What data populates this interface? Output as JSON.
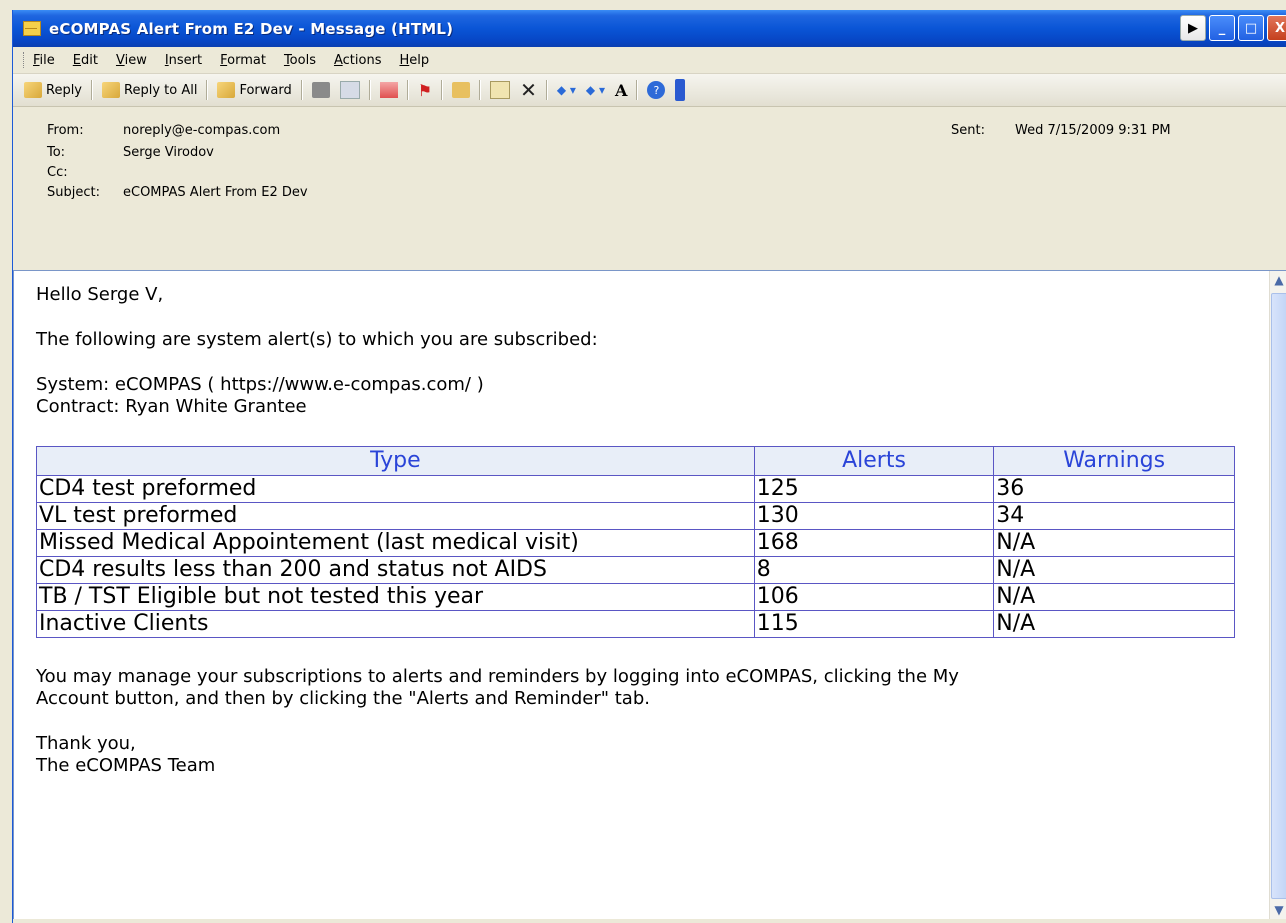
{
  "window": {
    "title": "eCOMPAS Alert From E2 Dev - Message (HTML)",
    "controls": {
      "play": "▶",
      "minimize": "_",
      "maximize": "□",
      "close": "X"
    }
  },
  "menu": [
    "File",
    "Edit",
    "View",
    "Insert",
    "Format",
    "Tools",
    "Actions",
    "Help"
  ],
  "toolbar": {
    "reply": "Reply",
    "reply_all": "Reply to All",
    "forward": "Forward",
    "font_size": "A",
    "help": "?"
  },
  "header": {
    "from_label": "From:",
    "from": "noreply@e-compas.com",
    "to_label": "To:",
    "to": "Serge Virodov",
    "cc_label": "Cc:",
    "cc": "",
    "subject_label": "Subject:",
    "subject": "eCOMPAS Alert From E2 Dev",
    "sent_label": "Sent:",
    "sent": "Wed 7/15/2009 9:31 PM"
  },
  "body": {
    "greeting": "Hello Serge V,",
    "intro": "The following are system alert(s) to which you are subscribed:",
    "system": "System: eCOMPAS ( https://www.e-compas.com/ )",
    "contract": "Contract: Ryan White Grantee",
    "table": {
      "headers": [
        "Type",
        "Alerts",
        "Warnings"
      ],
      "rows": [
        [
          "CD4 test preformed",
          "125",
          "36"
        ],
        [
          "VL test preformed",
          "130",
          "34"
        ],
        [
          "Missed Medical Appointement (last medical visit)",
          "168",
          "N/A"
        ],
        [
          "CD4 results less than 200 and status not AIDS",
          "8",
          "N/A"
        ],
        [
          "TB / TST Eligible but not tested this year",
          "106",
          "N/A"
        ],
        [
          "Inactive Clients",
          "115",
          "N/A"
        ]
      ]
    },
    "manage_line1": "You may manage your subscriptions to alerts and reminders by logging into eCOMPAS, clicking the My",
    "manage_line2": "Account button, and then by clicking the \"Alerts and Reminder\" tab.",
    "thanks": "Thank you,",
    "signature": "The eCOMPAS Team"
  }
}
